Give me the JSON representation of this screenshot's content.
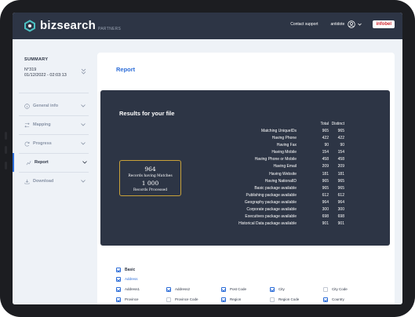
{
  "header": {
    "brand": "bizsearch",
    "brand_sub": "PARTNERS",
    "support_label": "Contact support",
    "user_name": "antidote",
    "partner_badge": "infobel"
  },
  "sidebar": {
    "summary_title": "SUMMARY",
    "summary_number": "N°319",
    "summary_date": "01/12/2022 - 02:03:13",
    "items": [
      {
        "label": "General info",
        "icon": "info-icon"
      },
      {
        "label": "Mapping",
        "icon": "mapping-icon"
      },
      {
        "label": "Progress",
        "icon": "progress-icon"
      },
      {
        "label": "Report",
        "icon": "report-icon",
        "active": true
      },
      {
        "label": "Download",
        "icon": "download-icon"
      }
    ]
  },
  "main": {
    "title": "Report",
    "results": {
      "title": "Results for your file",
      "box_value_1": "964",
      "box_label_1": "Records having Matches",
      "box_value_2": "1 000",
      "box_label_2": "Records Processed",
      "col_total": "Total",
      "col_distinct": "Distinct",
      "rows": [
        {
          "label": "Matching UniqueIDs",
          "total": "965",
          "distinct": "965"
        },
        {
          "label": "Having Phone",
          "total": "422",
          "distinct": "422"
        },
        {
          "label": "Having Fax",
          "total": "90",
          "distinct": "90"
        },
        {
          "label": "Having Mobile",
          "total": "154",
          "distinct": "154"
        },
        {
          "label": "Having Phone or Mobile",
          "total": "458",
          "distinct": "458"
        },
        {
          "label": "Having Email",
          "total": "209",
          "distinct": "209"
        },
        {
          "label": "Having Website",
          "total": "181",
          "distinct": "181"
        },
        {
          "label": "Having NationalID",
          "total": "965",
          "distinct": "965"
        },
        {
          "label": "Basic package available",
          "total": "965",
          "distinct": "965"
        },
        {
          "label": "Publishing package available",
          "total": "612",
          "distinct": "612"
        },
        {
          "label": "Geography package available",
          "total": "964",
          "distinct": "964"
        },
        {
          "label": "Corporate package available",
          "total": "300",
          "distinct": "300"
        },
        {
          "label": "Executives package available",
          "total": "698",
          "distinct": "698"
        },
        {
          "label": "Historical Data package available",
          "total": "901",
          "distinct": "901"
        }
      ]
    },
    "fields": {
      "group_label": "Basic",
      "subgroup_label": "Address",
      "items": [
        {
          "label": "Address1",
          "checked": true
        },
        {
          "label": "Address2",
          "checked": true
        },
        {
          "label": "Post Code",
          "checked": true
        },
        {
          "label": "City",
          "checked": true
        },
        {
          "label": "City Code",
          "checked": false
        },
        {
          "label": "Province",
          "checked": true
        },
        {
          "label": "Province Code",
          "checked": false
        },
        {
          "label": "Region",
          "checked": true
        },
        {
          "label": "Region Code",
          "checked": false
        },
        {
          "label": "Country",
          "checked": true
        },
        {
          "label": "Country Code",
          "checked": false
        }
      ]
    }
  },
  "colors": {
    "header_bg": "#2d3545",
    "accent": "#2b6cd8",
    "panel_bg": "#eef2f7",
    "box_border": "#c9a23a",
    "badge_red": "#d3262d"
  }
}
